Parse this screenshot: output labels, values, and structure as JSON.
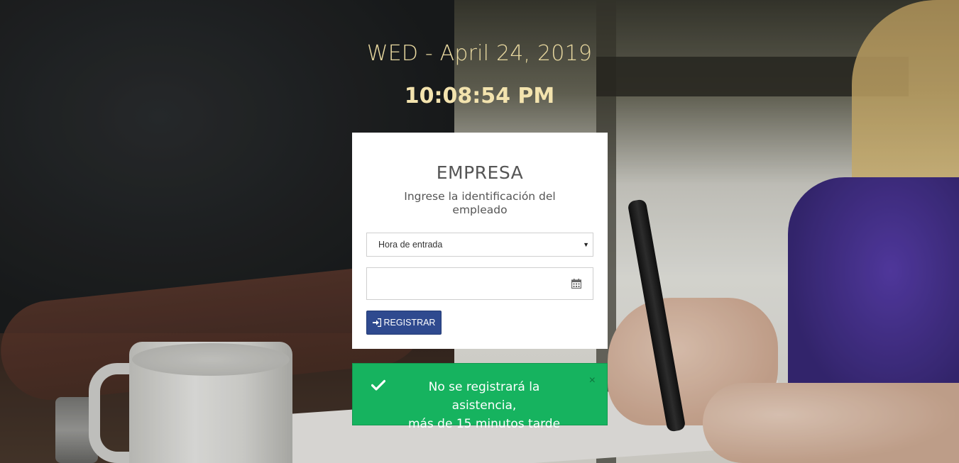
{
  "clock": {
    "date": "WED - April 24, 2019",
    "time": "10:08:54 PM"
  },
  "card": {
    "title": "EMPRESA",
    "subtitle": "Ingrese la identificación del empleado",
    "select": {
      "selected": "Hora de entrada"
    },
    "id_input": {
      "value": "",
      "icon": "calendar-icon"
    },
    "register_button": {
      "label": "REGISTRAR",
      "icon": "sign-in-icon"
    }
  },
  "alert": {
    "message_line1": "No se registrará la asistencia,",
    "message_line2": "más de 15 minutos tarde",
    "close": "×",
    "icon": "check-icon",
    "color": "#16b35f"
  },
  "colors": {
    "clock_text": "#e9d9a0",
    "button": "#2f4a8f"
  }
}
